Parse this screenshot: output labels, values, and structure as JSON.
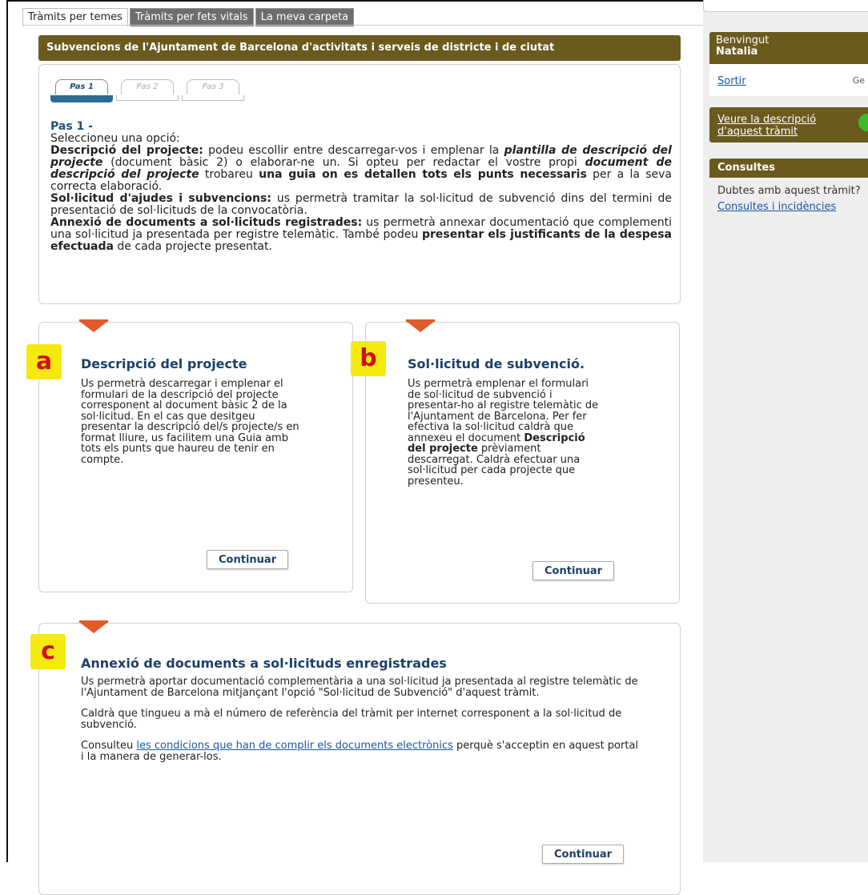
{
  "tabs": [
    {
      "label": "Tràmits per temes",
      "active": true
    },
    {
      "label": "Tràmits per fets vitals",
      "active": false
    },
    {
      "label": "La meva carpeta",
      "active": false
    }
  ],
  "title": "Subvencions de l'Ajuntament de Barcelona d'activitats i serveis de districte i de ciutat",
  "steps": [
    "Pas 1",
    "Pas 2",
    "Pas 3"
  ],
  "intro": {
    "heading": "Pas 1 -",
    "line1": "Seleccioneu una opció:",
    "p1_b1": "Descripció del projecte:",
    "p1_t1": " podeu escollir entre descarregar-vos i emplenar la ",
    "p1_bi1": "plantilla de descripció del projecte",
    "p1_t2": " (document bàsic 2) o elaborar-ne un. Si opteu per redactar el vostre propi ",
    "p1_bi2": "document de descripció del projecte",
    "p1_t3": " trobareu ",
    "p1_b2": "una guia on es detallen tots els punts necessaris",
    "p1_t4": " per a la seva correcta elaboració.",
    "p2_b": "Sol·licitud d'ajudes i subvencions:",
    "p2_t": " us permetrà tramitar la sol·licitud de subvenció dins del termini de presentació de sol·licituds de la convocatòria.",
    "p3_b": "Annexió de documents a sol·licituds registrades:",
    "p3_t1": " us permetrà annexar documentació que complementi una sol·licitud ja presentada per registre telemàtic. També podeu ",
    "p3_b2": "presentar els justificants de la despesa efectuada",
    "p3_t2": " de cada projecte presentat."
  },
  "option_a": {
    "badge": "a",
    "title": "Descripció del projecte",
    "desc": "Us permetrà descarregar i emplenar el formulari de la descripció del projecte corresponent al document bàsic 2 de la sol·licitud. En el cas que desitgeu presentar la descripció del/s projecte/s en format lliure, us facilitem una Guia amb tots els punts que haureu de tenir en compte.",
    "button": "Continuar"
  },
  "option_b": {
    "badge": "b",
    "title": "Sol·licitud de subvenció.",
    "desc1": "Us permetrà emplenar el formulari de sol·licitud de subvenció i presentar-ho al registre telemàtic de l'Ajuntament de Barcelona. Per fer efectiva la sol·licitud caldrà que annexeu el document ",
    "desc_b": "Descripció del projecte",
    "desc2": " prèviament descarregat. Caldrà efectuar una sol·licitud per cada projecte que presenteu.",
    "button": "Continuar"
  },
  "option_c": {
    "badge": "c",
    "title": "Annexió de documents a sol·licituds enregistrades",
    "p1": "Us permetrà aportar documentació complementària a una sol·licitud ja presentada al registre telemàtic de l'Ajuntament de Barcelona mitjançant l'opció \"Sol·licitud de Subvenció\" d'aquest tràmit.",
    "p2": "Caldrà que tingueu a mà el número de referència del tràmit per internet corresponent a la sol·licitud de subvenció.",
    "p3_pre": "Consulteu ",
    "p3_link": "les condicions que han de complir els documents electrònics",
    "p3_post": " perquè s'acceptin en aquest portal i la manera de generar-los.",
    "button": "Continuar"
  },
  "sidebar": {
    "welcome": "Benvingut",
    "user": "Natalia",
    "logout": "Sortir",
    "logout_extra": "Ge",
    "desc_link": "Veure la descripció d'aquest tràmit",
    "consult_head": "Consultes",
    "consult_text": "Dubtes amb aquest tràmit?",
    "consult_link": "Consultes i incidències"
  }
}
